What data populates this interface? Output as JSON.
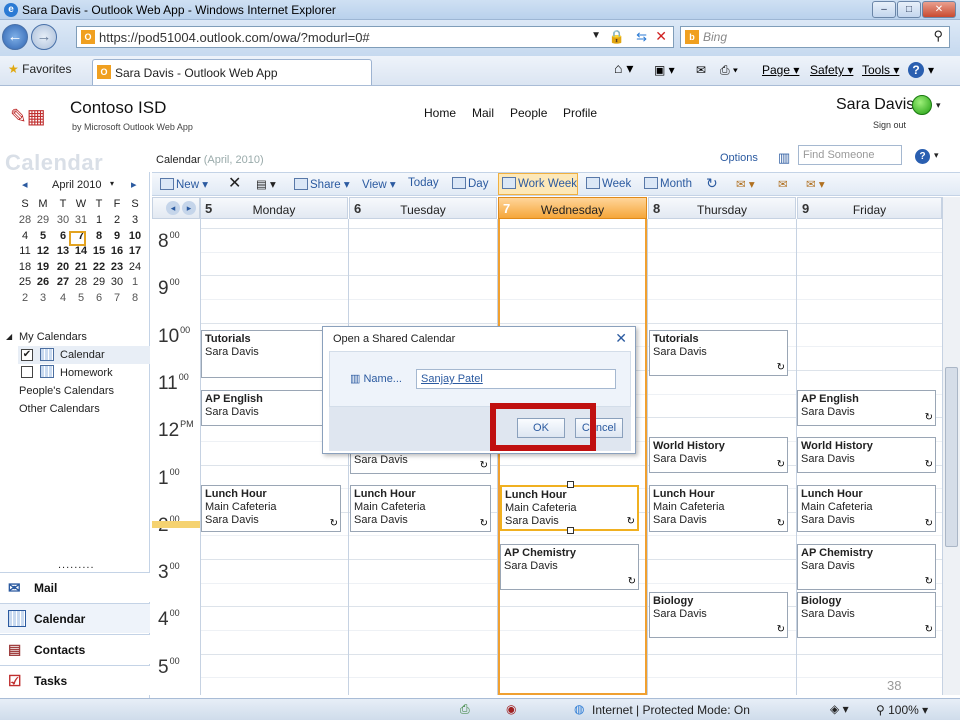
{
  "browser": {
    "title": "Sara Davis - Outlook Web App - Windows Internet Explorer",
    "url": "https://pod51004.outlook.com/owa/?modurl=0#",
    "search_placeholder": "Bing",
    "favorites_label": "Favorites",
    "tab_title": "Sara Davis - Outlook Web App",
    "menu": {
      "page": "Page",
      "safety": "Safety",
      "tools": "Tools"
    },
    "status": "Internet | Protected Mode: On",
    "zoom": "100%"
  },
  "owa": {
    "org": "Contoso ISD",
    "org_sub": "by Microsoft Outlook Web App",
    "nav": [
      "Home",
      "Mail",
      "People",
      "Profile"
    ],
    "user": "Sara Davis",
    "signout": "Sign out",
    "section_title": "Calendar",
    "calendar_label": "Calendar",
    "calendar_date": "(April, 2010)",
    "options": "Options",
    "find_placeholder": "Find Someone"
  },
  "toolbar": {
    "new": "New",
    "share": "Share",
    "view": "View",
    "today": "Today",
    "day": "Day",
    "work_week": "Work Week",
    "week": "Week",
    "month": "Month"
  },
  "minical": {
    "month": "April 2010",
    "weekdays": [
      "S",
      "M",
      "T",
      "W",
      "T",
      "F",
      "S"
    ],
    "rows": [
      [
        "28",
        "29",
        "30",
        "31",
        "1",
        "2",
        "3"
      ],
      [
        "4",
        "5",
        "6",
        "7",
        "8",
        "9",
        "10"
      ],
      [
        "11",
        "12",
        "13",
        "14",
        "15",
        "16",
        "17"
      ],
      [
        "18",
        "19",
        "20",
        "21",
        "22",
        "23",
        "24"
      ],
      [
        "25",
        "26",
        "27",
        "28",
        "29",
        "30",
        "1"
      ],
      [
        "2",
        "3",
        "4",
        "5",
        "6",
        "7",
        "8"
      ]
    ],
    "today": "7"
  },
  "leftnav": {
    "my_calendars": "My Calendars",
    "calendar": "Calendar",
    "homework": "Homework",
    "peoples": "People's Calendars",
    "other": "Other Calendars",
    "buttons": [
      "Mail",
      "Calendar",
      "Contacts",
      "Tasks"
    ]
  },
  "days": [
    {
      "num": "5",
      "name": "Monday"
    },
    {
      "num": "6",
      "name": "Tuesday"
    },
    {
      "num": "7",
      "name": "Wednesday"
    },
    {
      "num": "8",
      "name": "Thursday"
    },
    {
      "num": "9",
      "name": "Friday"
    }
  ],
  "hours": [
    {
      "h": "8",
      "s": "00"
    },
    {
      "h": "9",
      "s": "00"
    },
    {
      "h": "10",
      "s": "00"
    },
    {
      "h": "11",
      "s": "00"
    },
    {
      "h": "12",
      "s": "PM"
    },
    {
      "h": "1",
      "s": "00"
    },
    {
      "h": "2",
      "s": "00"
    },
    {
      "h": "3",
      "s": "00"
    },
    {
      "h": "4",
      "s": "00"
    },
    {
      "h": "5",
      "s": "00"
    }
  ],
  "events": {
    "mon_tutorials": {
      "title": "Tutorials",
      "who": "Sara Davis"
    },
    "mon_english": {
      "title": "AP English",
      "who": "Sara Davis"
    },
    "mon_lunch": {
      "title": "Lunch Hour",
      "where": "Main Cafeteria",
      "who": "Sara Davis"
    },
    "tue_partial": {
      "who": "Sara Davis"
    },
    "tue_lunch": {
      "title": "Lunch Hour",
      "where": "Main Cafeteria",
      "who": "Sara Davis"
    },
    "wed_lunch": {
      "title": "Lunch Hour",
      "where": "Main Cafeteria",
      "who": "Sara Davis"
    },
    "wed_chem": {
      "title": "AP Chemistry",
      "who": "Sara Davis"
    },
    "thu_tutorials": {
      "title": "Tutorials",
      "who": "Sara Davis"
    },
    "thu_history": {
      "title": "World History",
      "who": "Sara Davis"
    },
    "thu_lunch": {
      "title": "Lunch Hour",
      "where": "Main Cafeteria",
      "who": "Sara Davis"
    },
    "thu_bio": {
      "title": "Biology",
      "who": "Sara Davis"
    },
    "fri_english": {
      "title": "AP English",
      "who": "Sara Davis"
    },
    "fri_history": {
      "title": "World History",
      "who": "Sara Davis"
    },
    "fri_lunch": {
      "title": "Lunch Hour",
      "where": "Main Cafeteria",
      "who": "Sara Davis"
    },
    "fri_chem": {
      "title": "AP Chemistry",
      "who": "Sara Davis"
    },
    "fri_bio": {
      "title": "Biology",
      "who": "Sara Davis"
    }
  },
  "dialog": {
    "title": "Open a Shared Calendar",
    "name_label": "Name...",
    "name_value": "Sanjay Patel",
    "ok": "OK",
    "cancel": "Cancel"
  },
  "slide_number": "38"
}
